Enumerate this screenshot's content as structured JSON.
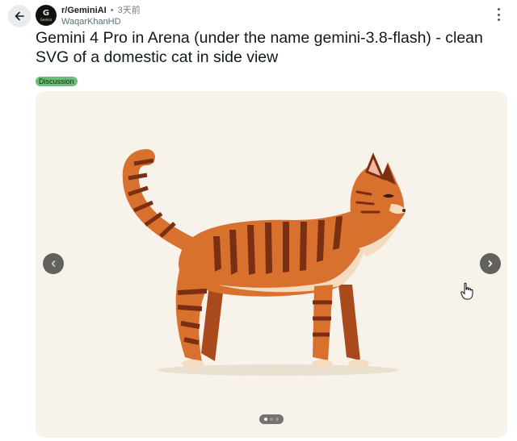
{
  "post": {
    "subreddit": "r/GeminiAI",
    "separator": "•",
    "time": "3天前",
    "author": "WaqarKhanHD",
    "title": "Gemini 4 Pro in Arena (under the name gemini-3.8-flash) - clean SVG of a domestic cat in side view",
    "flair": "Discussion"
  },
  "avatar": {
    "letter": "G",
    "sub": "Gemini"
  },
  "gallery": {
    "dot_count": 3,
    "active_index": 0
  },
  "icons": {
    "back": "arrow-left-icon",
    "more": "more-vertical-icon",
    "prev": "chevron-left-icon",
    "next": "chevron-right-icon",
    "cursor": "hand-pointer-icon"
  },
  "colors": {
    "flair_bg": "#6fbd7a",
    "gallery_bg": "#f7f3ea",
    "cat_fur": "#d9712e",
    "cat_stripe": "#7a2e12",
    "cat_belly": "#f4dcc0"
  }
}
